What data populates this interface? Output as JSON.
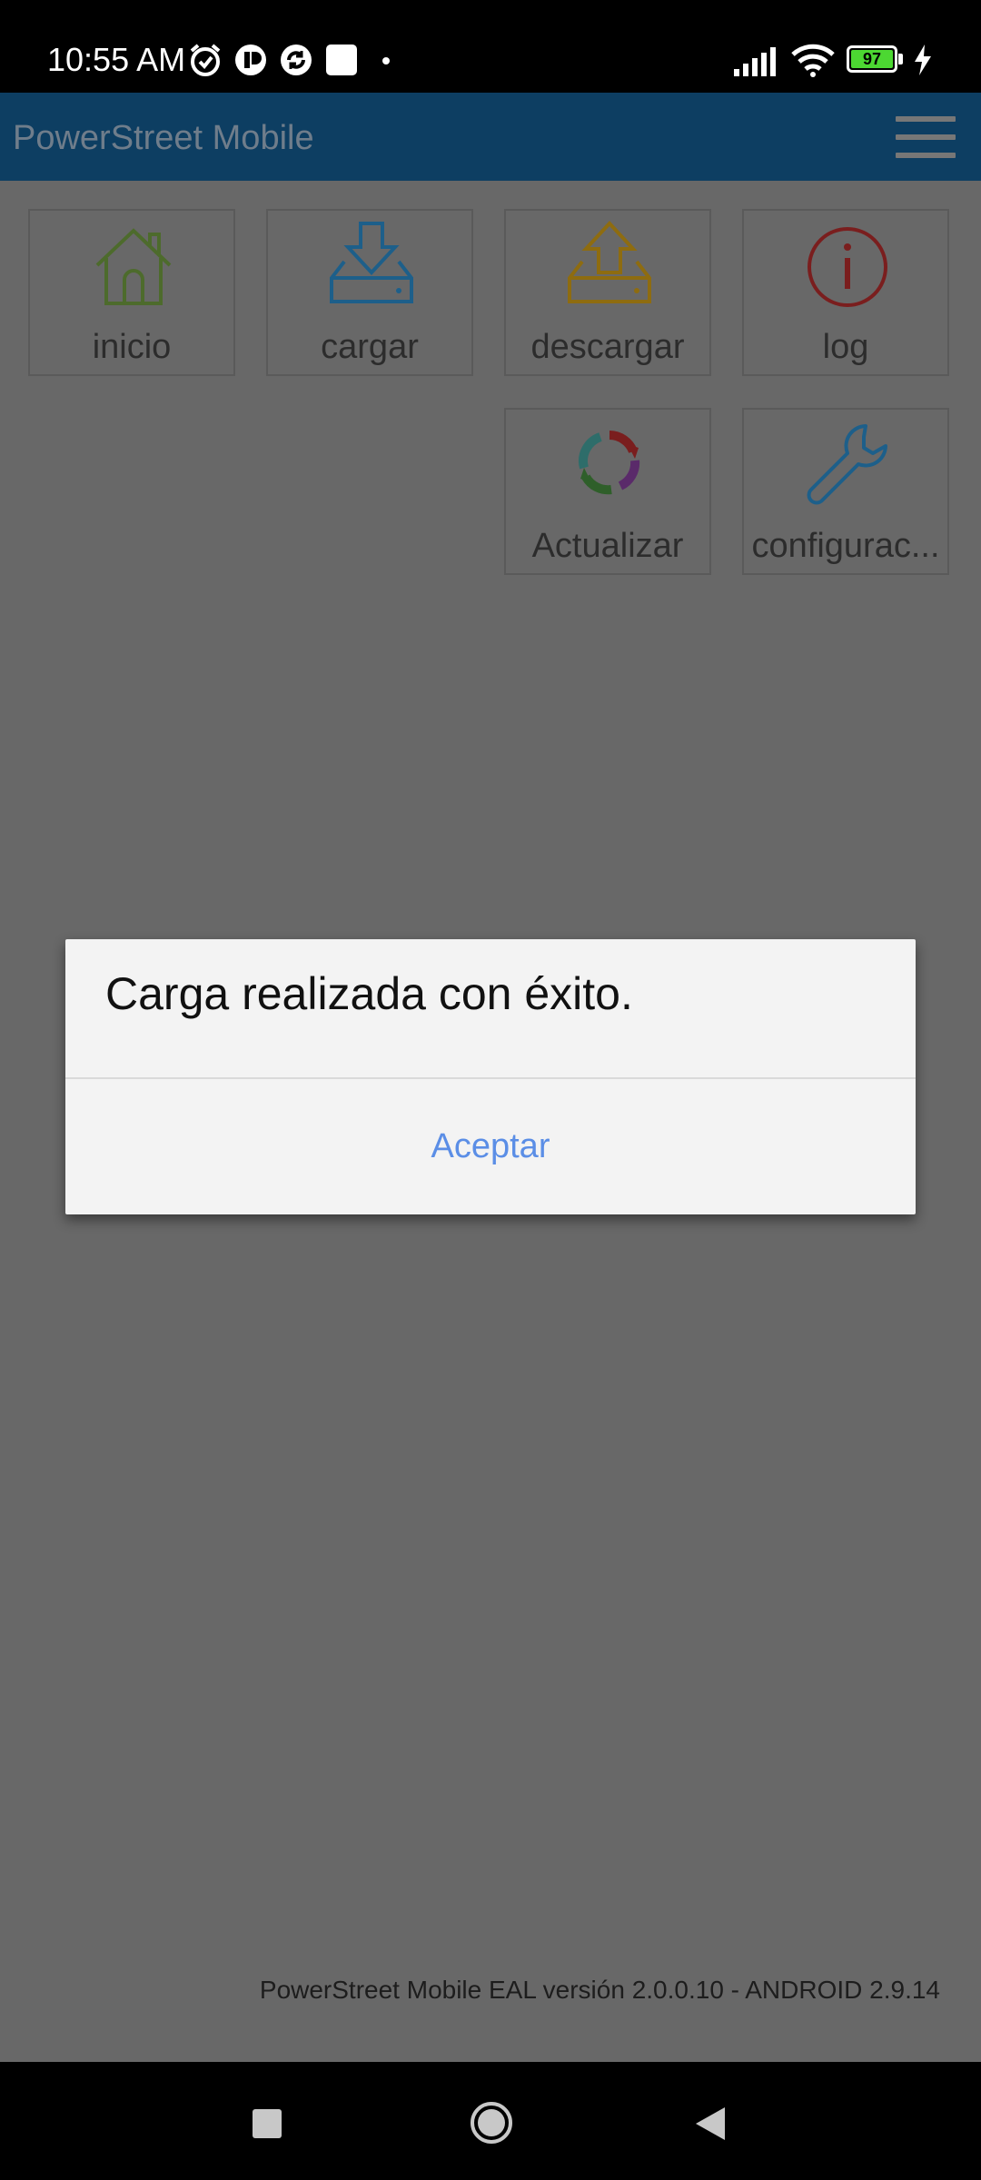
{
  "status_bar": {
    "time": "10:55 AM",
    "battery_level": "97",
    "icons": [
      "alarm-icon",
      "app-notification-icon",
      "sync-icon",
      "square-notification-icon",
      "dot-icon",
      "signal-icon",
      "wifi-icon",
      "battery-icon",
      "charging-icon"
    ]
  },
  "app_bar": {
    "title": "PowerStreet Mobile",
    "menu_icon": "hamburger-menu-icon"
  },
  "tiles": [
    {
      "label": "inicio",
      "icon": "home-icon",
      "color": "#4d6b2c"
    },
    {
      "label": "cargar",
      "icon": "upload-tray-icon",
      "color": "#1d5f8a"
    },
    {
      "label": "descargar",
      "icon": "download-tray-icon",
      "color": "#8e6c10"
    },
    {
      "label": "log",
      "icon": "info-icon",
      "color": "#7a1e1e"
    },
    {
      "label": "Actualizar",
      "icon": "refresh-icon",
      "color": "#3f6f9f"
    },
    {
      "label": "configurac...",
      "icon": "wrench-icon",
      "color": "#1d5f8a"
    }
  ],
  "dialog": {
    "message": "Carga realizada con éxito.",
    "button_label": "Aceptar",
    "button_color": "#5b8ee6"
  },
  "footer": {
    "version_text": "PowerStreet Mobile EAL versión 2.0.0.10 - ANDROID 2.9.14"
  },
  "nav_bar": {
    "icons": [
      "recents-icon",
      "home-circle-icon",
      "back-icon"
    ]
  }
}
